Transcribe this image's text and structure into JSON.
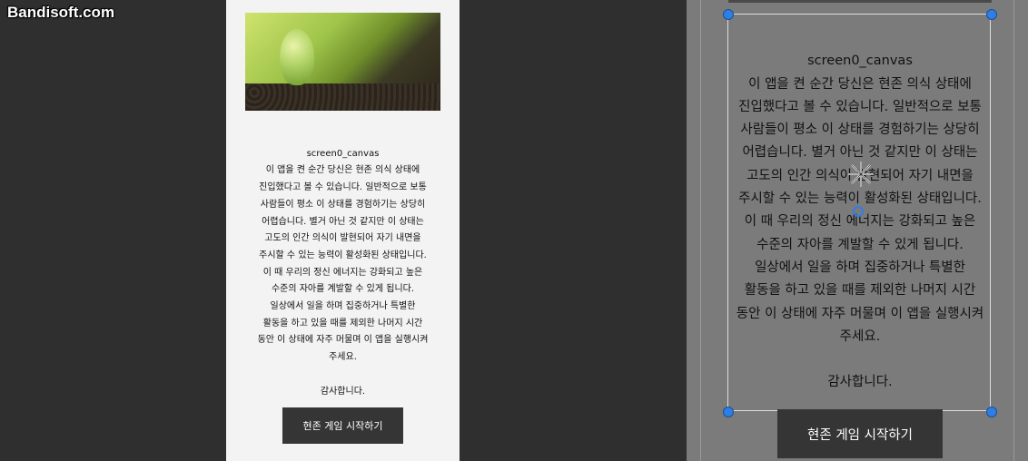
{
  "watermark": {
    "text": "Bandisoft.com"
  },
  "preview": {
    "image_alt": "sprout-in-soil",
    "canvas_name": "screen0_canvas",
    "body": "이 앱을 켠 순간 당신은 현존 의식 상태에\n진입했다고 볼 수 있습니다. 일반적으로 보통\n사람들이 평소 이 상태를 경험하기는 상당히\n어렵습니다. 별거 아닌 것 같지만 이 상태는\n고도의 인간 의식이 발현되어 자기 내면을\n주시할 수 있는 능력이 활성화된 상태입니다.\n이 때 우리의 정신 에너지는 강화되고 높은\n수준의 자아를 계발할 수 있게 됩니다.\n일상에서 일을 하며 집중하거나 특별한\n활동을 하고 있을 때를 제외한 나머지 시간\n동안 이 상태에 자주 머물며 이 앱을 실행시켜\n주세요.\n\n감사합니다.",
    "button_label": "현존 게임 시작하기"
  },
  "editor": {
    "canvas_name": "screen0_canvas",
    "body": "이 앱을 켠 순간 당신은 현존 의식 상태에\n진입했다고 볼 수 있습니다. 일반적으로 보통\n사람들이 평소 이 상태를 경험하기는 상당히\n어렵습니다. 별거 아닌 것 같지만 이 상태는\n고도의 인간 의식이 발현되어 자기 내면을\n주시할 수 있는 능력이 활성화된 상태입니다.\n이 때 우리의 정신 에너지는 강화되고 높은\n수준의 자아를 계발할 수 있게 됩니다.\n일상에서 일을 하며 집중하거나 특별한\n활동을 하고 있을 때를 제외한 나머지 시간\n동안 이 상태에 자주 머물며 이 앱을 실행시켜\n주세요.\n\n감사합니다.",
    "button_label": "현존 게임 시작하기"
  },
  "colors": {
    "background": "#2f2f2f",
    "preview_bg": "#f3f3f3",
    "editor_bg": "#7b7b7b",
    "button_bg": "#353535",
    "handle": "#2f7ee3"
  }
}
